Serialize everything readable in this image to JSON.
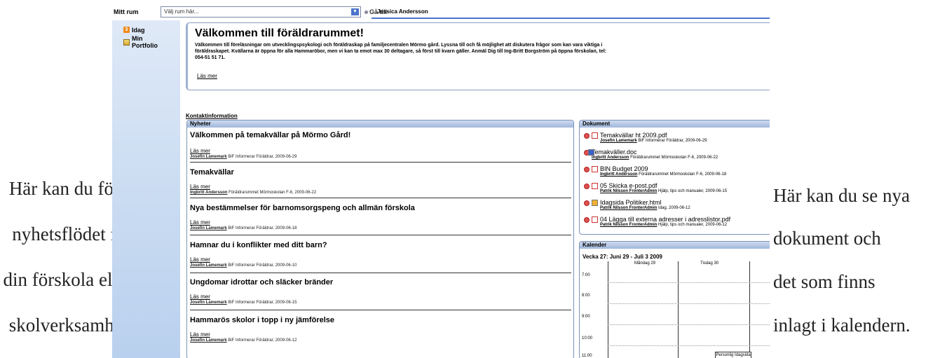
{
  "captions": {
    "left": [
      "Här kan du följa",
      "nyhetsflödet för",
      "din förskola eller",
      "skolverksamhet."
    ],
    "right": [
      "Här kan du se nya",
      "dokument och",
      "det som finns",
      "inlagt i kalendern."
    ]
  },
  "topbar": {
    "room_label": "Mitt rum",
    "room_select_value": "Välj rum här...",
    "go_label": "Gå till",
    "user_name": "Jessica Andersson"
  },
  "sidebar": {
    "items": [
      {
        "label": "Idag",
        "icon": "calendar-today-icon"
      },
      {
        "label": "Min Portfolio",
        "icon": "portfolio-icon"
      }
    ]
  },
  "welcome": {
    "title": "Välkommen till föräldrarummet!",
    "body": "Välkommen till föreläsningar om utvecklingspsykologi och föräldraskap på familjecentralen Mörmo gård. Lyssna till och få möjlighet att diskutera frågor som kan vara viktiga i föräldraskapet. Kvällarna är öppna för alla Hammaröbor, men vi kan ta emot max 30 deltagare, så först till kvarn gäller. Anmäl Dig till Ing-Britt Borgström på öppna förskolan, tel: 054-51 51 71.",
    "more": "Läs mer"
  },
  "contact_link": "Kontaktinformation",
  "news": {
    "header": "Nyheter",
    "items": [
      {
        "title": "Välkommen på temakvällar på Mörmo Gård!",
        "more": "Läs mer",
        "author": "Josefin Lamemark",
        "meta": " BiF Informerar Föräldrar, 2009-06-29"
      },
      {
        "title": "Temakvällar",
        "more": "Läs mer",
        "author": "Ingbritt Andersson",
        "meta": " Föräldrarummet Mörmoskolan F-6, 2009-06-22"
      },
      {
        "title": "Nya bestämmelser för barnomsorgspeng och allmän förskola",
        "more": "Läs mer",
        "author": "Josefin Lamemark",
        "meta": " BiF Informerar Föräldrar, 2009-06-18"
      },
      {
        "title": "Hamnar du i konflikter med ditt barn?",
        "more": "Läs mer",
        "author": "Josefin Lamemark",
        "meta": " BiF Informerar Föräldrar, 2009-06-10"
      },
      {
        "title": "Ungdomar idrottar och släcker bränder",
        "more": "Läs mer",
        "author": "Josefin Lamemark",
        "meta": " BiF Informerar Föräldrar, 2009-06-15"
      },
      {
        "title": "Hammarös skolor i topp i ny jämförelse",
        "more": "Läs mer",
        "author": "Josefin Lamemark",
        "meta": " BiF Informerar Föräldrar, 2009-06-12"
      }
    ]
  },
  "documents": {
    "header": "Dokument",
    "items": [
      {
        "name": "Temakvällar ht 2009.pdf",
        "author": "Josefin Lamemark",
        "meta": " BiF Informerar Föräldrar, 2009-06-29",
        "type": "pdf"
      },
      {
        "name": "Temakväller.doc",
        "author": "Ingbritt Andersson",
        "meta": " Föräldrarummet Mörmoskolan F-6, 2009-06-22",
        "type": "doc"
      },
      {
        "name": "BIN Budget 2009",
        "author": "Ingbritt Andersson",
        "meta": " Föräldrarummet Mörmoskolan F-6, 2009-06-18",
        "type": "pdf"
      },
      {
        "name": "05 Skicka e-post.pdf",
        "author": "Patrik Nilsson FronterAdmin",
        "meta": " Hjälp, tips och manualer, 2009-06-15",
        "type": "pdf"
      },
      {
        "name": "Idagsida Politiker.html",
        "author": "Patrik Nilsson FronterAdmin",
        "meta": " Idag, 2009-06-12",
        "type": "html"
      },
      {
        "name": "04 Lägga till externa adresser i adresslistor.pdf",
        "author": "Patrik Nilsson FronterAdmin",
        "meta": " Hjälp, tips och manualer, 2009-06-12",
        "type": "pdf"
      }
    ]
  },
  "calendar": {
    "header": "Kalender",
    "week": "Vecka 27: Juni 29 - Juli 3 2009",
    "days": [
      "Måndag 29",
      "Tisdag 30"
    ],
    "times": [
      "7:00",
      "8:00",
      "9:00",
      "10:00",
      "11:00"
    ],
    "event": "Personlig Idagsida"
  }
}
